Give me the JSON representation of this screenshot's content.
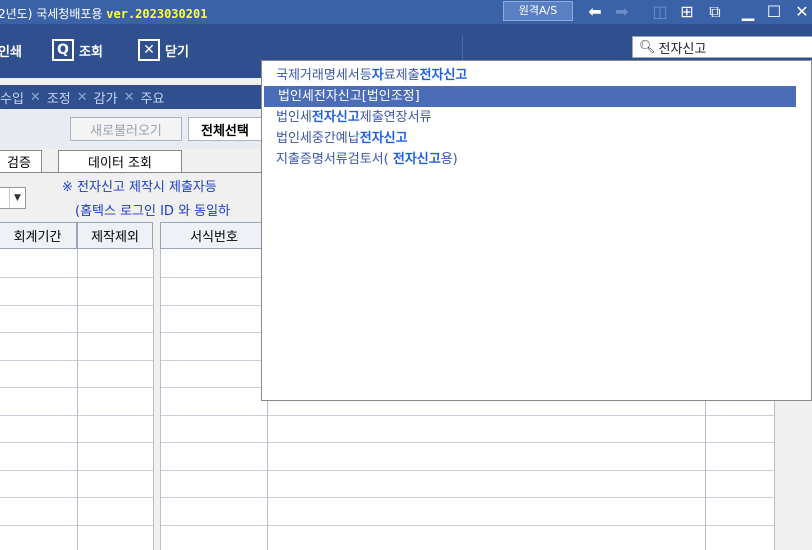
{
  "titlebar": {
    "title": "2년도)  국세청배포용 ",
    "version": "ver.2023030201",
    "remote_label": "원격A/S"
  },
  "toolbar": {
    "print_label": "인쇄",
    "lookup_label": "조회",
    "close_label": "닫기"
  },
  "search": {
    "value": "전자신고"
  },
  "tabs": [
    "수입",
    "조정",
    "감가",
    "주요"
  ],
  "buttons": {
    "reload_label": "새로불러오기",
    "select_all_label": "전체선택"
  },
  "subtabs": {
    "verify": "검증",
    "data_lookup": "데이터 조회"
  },
  "notes": {
    "line1": "※ 전자신고 제작시 제출자등",
    "line2": "(홈텍스 로그인 ID 와 동일하"
  },
  "grid": {
    "headers": {
      "period": "회계기간",
      "exclude": "제작제외",
      "form_no": "서식번호"
    }
  },
  "dropdown": {
    "items": [
      {
        "pre": "국제거래명세서등",
        "hl1": "자",
        "mid": "료제출",
        "hl2": "전자신고",
        "post": ""
      },
      {
        "pre": "법인세전자신고[법인조정]",
        "hl1": "",
        "mid": "",
        "hl2": "",
        "post": ""
      },
      {
        "pre": "법인세",
        "hl1": "",
        "mid": "",
        "hl2": "전자신고",
        "post": "제출연장서류"
      },
      {
        "pre": "법인세중간예납",
        "hl1": "",
        "mid": "",
        "hl2": "전자신고",
        "post": ""
      },
      {
        "pre": "지출증명서류검토서( ",
        "hl1": "",
        "mid": "",
        "hl2": "전자신고",
        "post": "용)"
      }
    ],
    "selected_index": 1
  }
}
